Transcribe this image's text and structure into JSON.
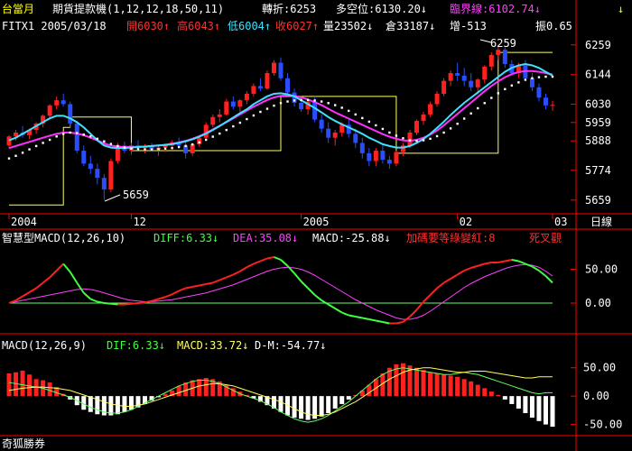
{
  "header": {
    "title": "台當月",
    "study": "期貨提款機(1,12,12,18,50,11)",
    "turn_label": "轉折:6253",
    "stance_label": "多空位:6130.20↓",
    "critical_label": "臨界線:6102.74↓",
    "arrow_right": "↓"
  },
  "quote": {
    "symbol_date": "FITX1 2005/03/18",
    "open": "開6030↑",
    "high": "高6043↑",
    "low": "低6004↑",
    "close": "收6027↑",
    "volume": "量23502↓",
    "oi": "倉33187↓",
    "change": "增-513",
    "amp": "振0.65"
  },
  "macd_panel": {
    "title": "智慧型MACD(12,26,10)",
    "diff": "DIFF:6.33↓",
    "dea": "DEA:35.08↓",
    "macd": "MACD:-25.88↓",
    "signal": "加碼要等綠變紅:8",
    "cross": "死叉觀"
  },
  "macd2_panel": {
    "title": "MACD(12,26,9)",
    "dif": "DIF:6.33↓",
    "macd": "MACD:33.72↓",
    "dm": "D-M:-54.77↓"
  },
  "footer": {
    "brand": "奇狐勝券",
    "period": "日線"
  },
  "annotations": {
    "low": "5659",
    "high": "6259"
  },
  "colors": {
    "up": "#ff2020",
    "down": "#2a4dff",
    "ma": "#40e0ff",
    "ma2": "#ff30ff",
    "dots": "#ffffff",
    "step": "#ffff60"
  },
  "chart_data": [
    {
      "type": "candlestick",
      "title": "",
      "ylim": [
        5620,
        6300
      ],
      "yticks": [
        6259,
        6144,
        6030,
        5959,
        5888,
        5774,
        5659
      ],
      "xticks": [
        "2004",
        "12",
        "2005",
        "02",
        "03"
      ],
      "candles": [
        [
          5870,
          5910,
          5860,
          5905
        ],
        [
          5905,
          5930,
          5890,
          5920
        ],
        [
          5920,
          5945,
          5900,
          5910
        ],
        [
          5910,
          5935,
          5895,
          5930
        ],
        [
          5930,
          5960,
          5915,
          5955
        ],
        [
          5955,
          5990,
          5940,
          5985
        ],
        [
          5985,
          6030,
          5970,
          6025
        ],
        [
          6025,
          6060,
          6010,
          6045
        ],
        [
          6045,
          6070,
          6020,
          6030
        ],
        [
          6030,
          6040,
          5940,
          5955
        ],
        [
          5955,
          5965,
          5840,
          5850
        ],
        [
          5850,
          5870,
          5790,
          5800
        ],
        [
          5800,
          5830,
          5760,
          5780
        ],
        [
          5780,
          5800,
          5720,
          5745
        ],
        [
          5745,
          5760,
          5659,
          5700
        ],
        [
          5700,
          5820,
          5690,
          5810
        ],
        [
          5810,
          5880,
          5800,
          5870
        ],
        [
          5870,
          5885,
          5840,
          5850
        ],
        [
          5850,
          5880,
          5835,
          5870
        ],
        [
          5870,
          5890,
          5850,
          5860
        ],
        [
          5860,
          5875,
          5840,
          5868
        ],
        [
          5868,
          5880,
          5845,
          5855
        ],
        [
          5855,
          5870,
          5830,
          5862
        ],
        [
          5862,
          5878,
          5845,
          5870
        ],
        [
          5870,
          5890,
          5855,
          5882
        ],
        [
          5882,
          5900,
          5860,
          5870
        ],
        [
          5870,
          5885,
          5820,
          5840
        ],
        [
          5840,
          5880,
          5830,
          5875
        ],
        [
          5875,
          5910,
          5865,
          5900
        ],
        [
          5900,
          5960,
          5890,
          5950
        ],
        [
          5950,
          5990,
          5940,
          5980
        ],
        [
          5980,
          6010,
          5960,
          5990
        ],
        [
          5990,
          6050,
          5985,
          6040
        ],
        [
          6040,
          6060,
          6010,
          6020
        ],
        [
          6020,
          6050,
          6000,
          6045
        ],
        [
          6045,
          6080,
          6030,
          6070
        ],
        [
          6070,
          6110,
          6060,
          6100
        ],
        [
          6100,
          6130,
          6080,
          6090
        ],
        [
          6090,
          6160,
          6085,
          6150
        ],
        [
          6150,
          6200,
          6140,
          6190
        ],
        [
          6190,
          6210,
          6120,
          6130
        ],
        [
          6130,
          6150,
          6060,
          6075
        ],
        [
          6075,
          6090,
          6020,
          6035
        ],
        [
          6035,
          6060,
          6000,
          6010
        ],
        [
          6010,
          6050,
          5990,
          6040
        ],
        [
          6040,
          6060,
          5960,
          5970
        ],
        [
          5970,
          5990,
          5920,
          5935
        ],
        [
          5935,
          5960,
          5880,
          5900
        ],
        [
          5900,
          5930,
          5870,
          5920
        ],
        [
          5920,
          5960,
          5905,
          5950
        ],
        [
          5950,
          5970,
          5900,
          5915
        ],
        [
          5915,
          5935,
          5860,
          5880
        ],
        [
          5880,
          5900,
          5820,
          5840
        ],
        [
          5840,
          5860,
          5790,
          5810
        ],
        [
          5810,
          5860,
          5790,
          5850
        ],
        [
          5850,
          5870,
          5800,
          5815
        ],
        [
          5815,
          5830,
          5780,
          5800
        ],
        [
          5800,
          5850,
          5790,
          5845
        ],
        [
          5845,
          5880,
          5830,
          5870
        ],
        [
          5870,
          5930,
          5860,
          5920
        ],
        [
          5920,
          5970,
          5910,
          5965
        ],
        [
          5965,
          6000,
          5950,
          5990
        ],
        [
          5990,
          6040,
          5980,
          6030
        ],
        [
          6030,
          6080,
          6020,
          6070
        ],
        [
          6070,
          6130,
          6060,
          6120
        ],
        [
          6120,
          6160,
          6100,
          6150
        ],
        [
          6150,
          6190,
          6120,
          6140
        ],
        [
          6140,
          6170,
          6100,
          6120
        ],
        [
          6120,
          6150,
          6080,
          6095
        ],
        [
          6095,
          6130,
          6070,
          6125
        ],
        [
          6125,
          6180,
          6110,
          6175
        ],
        [
          6175,
          6230,
          6160,
          6220
        ],
        [
          6220,
          6259,
          6200,
          6240
        ],
        [
          6240,
          6250,
          6170,
          6185
        ],
        [
          6185,
          6200,
          6140,
          6150
        ],
        [
          6150,
          6190,
          6130,
          6180
        ],
        [
          6180,
          6200,
          6120,
          6130
        ],
        [
          6130,
          6150,
          6080,
          6095
        ],
        [
          6095,
          6110,
          6040,
          6055
        ],
        [
          6055,
          6070,
          6010,
          6025
        ],
        [
          6025,
          6043,
          6004,
          6027
        ]
      ],
      "ma_cyan": [
        5890,
        5900,
        5915,
        5930,
        5945,
        5960,
        5975,
        5985,
        5985,
        5975,
        5960,
        5940,
        5915,
        5890,
        5870,
        5862,
        5860,
        5860,
        5862,
        5864,
        5866,
        5868,
        5870,
        5872,
        5875,
        5880,
        5886,
        5894,
        5904,
        5916,
        5930,
        5945,
        5962,
        5978,
        5995,
        6010,
        6030,
        6045,
        6060,
        6070,
        6072,
        6068,
        6060,
        6045,
        6030,
        6015,
        5998,
        5980,
        5965,
        5952,
        5940,
        5928,
        5915,
        5900,
        5888,
        5875,
        5868,
        5862,
        5862,
        5868,
        5880,
        5895,
        5915,
        5938,
        5962,
        5988,
        6012,
        6035,
        6055,
        6075,
        6095,
        6115,
        6135,
        6155,
        6170,
        6180,
        6185,
        6180,
        6170,
        6155,
        6140
      ],
      "ma_magenta": [
        5860,
        5868,
        5876,
        5884,
        5892,
        5900,
        5908,
        5915,
        5920,
        5920,
        5916,
        5910,
        5900,
        5890,
        5878,
        5870,
        5866,
        5864,
        5864,
        5865,
        5866,
        5868,
        5870,
        5873,
        5877,
        5882,
        5888,
        5896,
        5906,
        5918,
        5932,
        5946,
        5960,
        5975,
        5990,
        6005,
        6020,
        6033,
        6046,
        6056,
        6062,
        6064,
        6062,
        6056,
        6048,
        6038,
        6026,
        6012,
        5998,
        5986,
        5974,
        5962,
        5950,
        5938,
        5926,
        5914,
        5904,
        5896,
        5890,
        5888,
        5892,
        5900,
        5912,
        5928,
        5948,
        5970,
        5992,
        6014,
        6036,
        6058,
        6080,
        6100,
        6118,
        6134,
        6146,
        6154,
        6158,
        6158,
        6155,
        6150,
        6144
      ],
      "dots_white": [
        5820,
        5830,
        5842,
        5855,
        5868,
        5880,
        5892,
        5905,
        5915,
        5920,
        5918,
        5912,
        5905,
        5896,
        5886,
        5876,
        5868,
        5862,
        5858,
        5856,
        5855,
        5855,
        5856,
        5858,
        5860,
        5864,
        5868,
        5874,
        5882,
        5892,
        5904,
        5916,
        5930,
        5944,
        5958,
        5972,
        5986,
        6000,
        6012,
        6024,
        6034,
        6040,
        6044,
        6046,
        6046,
        6044,
        6040,
        6034,
        6026,
        6016,
        6004,
        5990,
        5976,
        5962,
        5948,
        5934,
        5920,
        5908,
        5898,
        5890,
        5888,
        5890,
        5896,
        5906,
        5920,
        5936,
        5954,
        5974,
        5994,
        6014,
        6034,
        6054,
        6072,
        6088,
        6102,
        6114,
        6124,
        6130,
        6134,
        6136,
        6136
      ],
      "step_yellow": [
        5640,
        5640,
        5640,
        5640,
        5640,
        5640,
        5640,
        5640,
        5940,
        5980,
        5980,
        5980,
        5980,
        5980,
        5980,
        5980,
        5980,
        5980,
        5850,
        5850,
        5850,
        5850,
        5850,
        5850,
        5850,
        5850,
        5850,
        5850,
        5850,
        5850,
        5850,
        5850,
        5850,
        5850,
        5850,
        5850,
        5850,
        5850,
        5850,
        5850,
        6060,
        6060,
        6060,
        6060,
        6060,
        6060,
        6060,
        6060,
        6060,
        6060,
        6060,
        6060,
        6060,
        6060,
        6060,
        6060,
        6060,
        5840,
        5840,
        5840,
        5840,
        5840,
        5840,
        5840,
        5840,
        5840,
        5840,
        5840,
        5840,
        5840,
        5840,
        5840,
        6230,
        6230,
        6230,
        6230,
        6230,
        6230,
        6230,
        6230,
        6230
      ]
    },
    {
      "type": "line",
      "title": "",
      "ylim": [
        -40,
        80
      ],
      "yticks": [
        50,
        0
      ],
      "series": [
        {
          "name": "DIFF",
          "values": [
            0,
            4,
            10,
            16,
            22,
            30,
            38,
            48,
            58,
            46,
            30,
            15,
            6,
            2,
            0,
            -1,
            -2,
            -2,
            -1,
            0,
            1,
            3,
            6,
            9,
            13,
            18,
            22,
            24,
            26,
            28,
            30,
            34,
            38,
            42,
            47,
            53,
            58,
            62,
            66,
            68,
            64,
            55,
            44,
            32,
            22,
            12,
            4,
            -2,
            -8,
            -14,
            -18,
            -20,
            -22,
            -24,
            -26,
            -28,
            -30,
            -30,
            -28,
            -20,
            -10,
            2,
            12,
            22,
            30,
            36,
            42,
            48,
            52,
            55,
            58,
            60,
            60,
            62,
            64,
            62,
            58,
            54,
            48,
            40,
            30
          ]
        },
        {
          "name": "DEA",
          "values": [
            0,
            2,
            4,
            6,
            8,
            10,
            12,
            14,
            16,
            18,
            20,
            21,
            20,
            18,
            15,
            12,
            9,
            6,
            4,
            3,
            2,
            2,
            3,
            4,
            5,
            7,
            9,
            11,
            13,
            15,
            18,
            21,
            24,
            27,
            31,
            35,
            39,
            43,
            47,
            50,
            52,
            53,
            52,
            50,
            46,
            41,
            35,
            29,
            23,
            17,
            11,
            5,
            0,
            -5,
            -10,
            -14,
            -18,
            -22,
            -24,
            -24,
            -22,
            -18,
            -12,
            -5,
            2,
            9,
            16,
            23,
            29,
            34,
            39,
            43,
            47,
            51,
            54,
            56,
            57,
            56,
            53,
            47,
            40
          ]
        }
      ]
    },
    {
      "type": "bar",
      "title": "",
      "ylim": [
        -65,
        75
      ],
      "yticks": [
        50,
        0,
        -50
      ],
      "hist": [
        40,
        42,
        45,
        38,
        30,
        28,
        24,
        16,
        4,
        -6,
        -16,
        -24,
        -28,
        -32,
        -34,
        -34,
        -32,
        -28,
        -24,
        -20,
        -14,
        -8,
        -2,
        4,
        10,
        18,
        24,
        28,
        30,
        32,
        30,
        26,
        20,
        14,
        8,
        2,
        -4,
        -10,
        -16,
        -22,
        -28,
        -34,
        -38,
        -40,
        -42,
        -40,
        -36,
        -30,
        -22,
        -14,
        -6,
        2,
        10,
        20,
        30,
        40,
        50,
        56,
        58,
        54,
        50,
        46,
        42,
        40,
        38,
        36,
        34,
        30,
        26,
        20,
        14,
        8,
        2,
        -6,
        -14,
        -22,
        -30,
        -38,
        -44,
        -50,
        -54
      ],
      "series": [
        {
          "name": "DIF",
          "values": [
            24,
            22,
            20,
            18,
            16,
            14,
            10,
            6,
            2,
            -2,
            -8,
            -14,
            -20,
            -24,
            -28,
            -30,
            -30,
            -28,
            -24,
            -18,
            -12,
            -6,
            0,
            6,
            12,
            18,
            22,
            26,
            28,
            28,
            26,
            22,
            16,
            10,
            4,
            0,
            -4,
            -8,
            -14,
            -20,
            -28,
            -34,
            -40,
            -44,
            -46,
            -44,
            -40,
            -34,
            -26,
            -18,
            -10,
            0,
            10,
            20,
            30,
            38,
            44,
            48,
            50,
            48,
            46,
            44,
            42,
            40,
            38,
            38,
            40,
            42,
            40,
            38,
            34,
            30,
            26,
            22,
            18,
            14,
            10,
            6,
            4,
            6,
            6
          ]
        },
        {
          "name": "MACD",
          "values": [
            10,
            12,
            14,
            15,
            16,
            16,
            15,
            14,
            12,
            10,
            6,
            2,
            -2,
            -6,
            -10,
            -14,
            -16,
            -18,
            -18,
            -16,
            -14,
            -10,
            -6,
            -2,
            2,
            6,
            10,
            14,
            18,
            20,
            22,
            22,
            20,
            18,
            14,
            10,
            6,
            2,
            -2,
            -6,
            -10,
            -16,
            -22,
            -28,
            -32,
            -34,
            -34,
            -32,
            -28,
            -22,
            -16,
            -10,
            -2,
            6,
            14,
            22,
            30,
            36,
            42,
            46,
            48,
            50,
            50,
            48,
            46,
            44,
            42,
            42,
            44,
            44,
            44,
            42,
            40,
            38,
            36,
            34,
            32,
            32,
            34,
            34,
            34
          ]
        }
      ]
    }
  ]
}
